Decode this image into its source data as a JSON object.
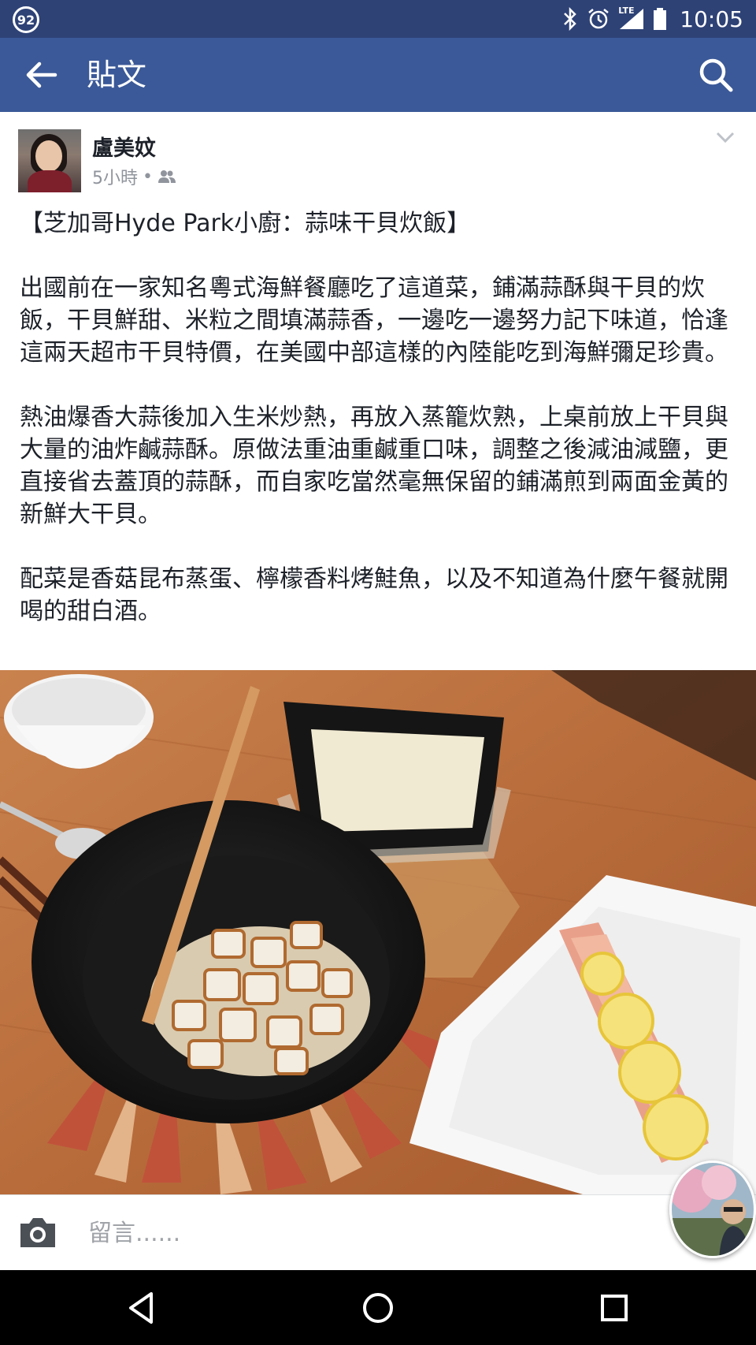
{
  "status_bar": {
    "notification_count": "92",
    "network": "LTE",
    "time": "10:05"
  },
  "app_bar": {
    "title": "貼文",
    "back_icon": "arrow-left-icon",
    "search_icon": "search-icon"
  },
  "post": {
    "author": "盧美妏",
    "time_ago": "5小時",
    "separator": "•",
    "audience_icon": "friends-icon",
    "paragraphs": [
      "【芝加哥Hyde Park小廚：蒜味干貝炊飯】",
      "出國前在一家知名粵式海鮮餐廳吃了這道菜，鋪滿蒜酥與干貝的炊飯，干貝鮮甜、米粒之間填滿蒜香，一邊吃一邊努力記下味道，恰逢這兩天超市干貝特價，在美國中部這樣的內陸能吃到海鮮彌足珍貴。",
      "熱油爆香大蒜後加入生米炒熱，再放入蒸籠炊熟，上桌前放上干貝與大量的油炸鹹蒜酥。原做法重油重鹹重口味，調整之後減油減鹽，更直接省去蓋頂的蒜酥，而自家吃當然毫無保留的鋪滿煎到兩面金黃的新鮮大干貝。",
      "配菜是香菇昆布蒸蛋、檸檬香料烤鮭魚，以及不知道為什麼午餐就開喝的甜白酒。"
    ]
  },
  "comment_bar": {
    "placeholder": "留言......",
    "camera_icon": "camera-icon"
  },
  "nav_bar": {
    "back_icon": "nav-back-icon",
    "home_icon": "nav-home-icon",
    "recents_icon": "nav-recents-icon"
  },
  "colors": {
    "status_bar": "#2e4276",
    "app_bar": "#3b5998",
    "text": "#1d2129",
    "secondary_text": "#90949c"
  }
}
